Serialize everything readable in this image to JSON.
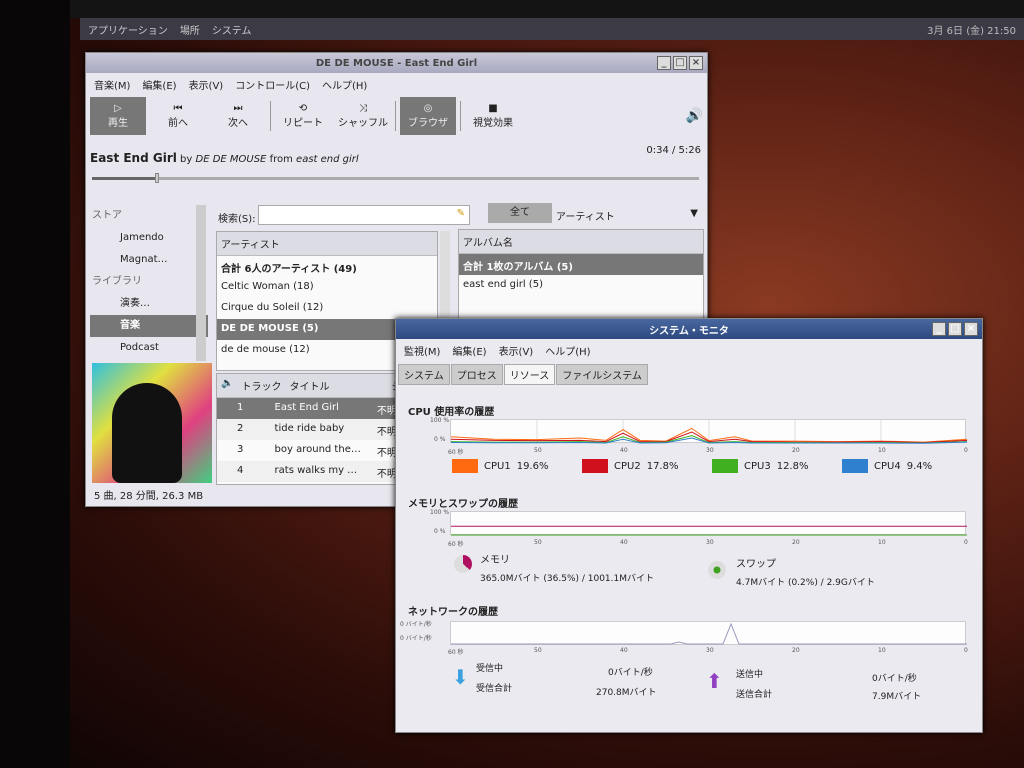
{
  "panel": {
    "menus": [
      "アプリケーション",
      "場所",
      "システム"
    ],
    "clock": "3月 6日 (金) 21:50"
  },
  "player": {
    "title": "DE DE MOUSE - East End Girl",
    "menus": [
      "音楽(M)",
      "編集(E)",
      "表示(V)",
      "コントロール(C)",
      "ヘルプ(H)"
    ],
    "toolbar": [
      "再生",
      "前へ",
      "次へ",
      "リピート",
      "シャッフル",
      "ブラウザ",
      "視覚効果"
    ],
    "now_playing": {
      "title": "East End Girl",
      "by": "by",
      "artist": "DE DE MOUSE",
      "from": "from",
      "album": "east end girl"
    },
    "time": "0:34 / 5:26",
    "progress": 0.104,
    "sidebar": [
      {
        "label": "ストア",
        "type": "header"
      },
      {
        "label": "Jamendo"
      },
      {
        "label": "Magnat…"
      },
      {
        "label": "ライブラリ",
        "type": "header"
      },
      {
        "label": "演奏…"
      },
      {
        "label": "音楽",
        "selected": true
      },
      {
        "label": "Podcast"
      }
    ],
    "search_label": "検索(S):",
    "search_value": "",
    "all_button": "全て",
    "filter_select": "アーティスト",
    "artists_header": "アーティスト",
    "artists": [
      "合計 6人のアーティスト (49)",
      "Celtic Woman (18)",
      "Cirque du Soleil (12)",
      "DE DE MOUSE (5)",
      "de de mouse (12)"
    ],
    "albums_header": "アルバム名",
    "albums": [
      "合計 1枚のアルバム (5)",
      "east end girl (5)"
    ],
    "track_headers": [
      "トラック",
      "タイトル",
      "ジャ"
    ],
    "tracks": [
      {
        "n": "1",
        "title": "East End Girl",
        "genre": "不明"
      },
      {
        "n": "2",
        "title": "tide ride baby",
        "genre": "不明"
      },
      {
        "n": "3",
        "title": "boy around the…",
        "genre": "不明"
      },
      {
        "n": "4",
        "title": "rats walks my …",
        "genre": "不明"
      }
    ],
    "status": "5 曲, 28 分間, 26.3 MB"
  },
  "monitor": {
    "title": "システム・モニタ",
    "menus": [
      "監視(M)",
      "編集(E)",
      "表示(V)",
      "ヘルプ(H)"
    ],
    "tabs": [
      "システム",
      "プロセス",
      "リソース",
      "ファイルシステム"
    ],
    "active_tab": "リソース",
    "cpu_title": "CPU 使用率の履歴",
    "mem_title": "メモリとスワップの履歴",
    "net_title": "ネットワークの履歴",
    "y_labels": [
      "100 %",
      "0 %"
    ],
    "net_y_labels": [
      "0 バイト/秒",
      "0 バイト/秒"
    ],
    "x_ticks": [
      "60 秒",
      "50",
      "40",
      "30",
      "20",
      "10",
      "0"
    ],
    "cpus": [
      {
        "name": "CPU1",
        "value": "19.6%",
        "color": "#ff6a10"
      },
      {
        "name": "CPU2",
        "value": "17.8%",
        "color": "#d0101c"
      },
      {
        "name": "CPU3",
        "value": "12.8%",
        "color": "#40b020"
      },
      {
        "name": "CPU4",
        "value": "9.4%",
        "color": "#3080d0"
      }
    ],
    "memory": {
      "label": "メモリ",
      "value": "365.0Mバイト (36.5%) / 1001.1Mバイト",
      "percent": 36.5,
      "color": "#b01060"
    },
    "swap": {
      "label": "スワップ",
      "value": "4.7Mバイト (0.2%) / 2.9Gバイト",
      "percent": 0.2,
      "color": "#40a020"
    },
    "net": {
      "recv_label": "受信中",
      "recv_total_label": "受信合計",
      "recv_rate": "0バイト/秒",
      "recv_total": "270.8Mバイト",
      "send_label": "送信中",
      "send_total_label": "送信合計",
      "send_rate": "0バイト/秒",
      "send_total": "7.9Mバイト"
    },
    "chart_data": {
      "type": "line",
      "x": [
        60,
        55,
        50,
        45,
        42,
        40,
        38,
        35,
        32,
        30,
        27,
        25,
        20,
        15,
        10,
        5,
        0
      ],
      "series": [
        {
          "name": "CPU1",
          "values": [
            30,
            20,
            18,
            25,
            15,
            60,
            15,
            12,
            65,
            14,
            30,
            12,
            12,
            10,
            12,
            8,
            20
          ]
        },
        {
          "name": "CPU2",
          "values": [
            20,
            15,
            14,
            15,
            10,
            45,
            10,
            10,
            50,
            10,
            20,
            10,
            8,
            8,
            10,
            6,
            15
          ]
        },
        {
          "name": "CPU3",
          "values": [
            10,
            8,
            8,
            10,
            6,
            30,
            6,
            8,
            35,
            6,
            10,
            6,
            6,
            5,
            6,
            4,
            10
          ]
        },
        {
          "name": "CPU4",
          "values": [
            6,
            5,
            5,
            6,
            4,
            20,
            4,
            5,
            25,
            4,
            6,
            4,
            4,
            4,
            4,
            3,
            8
          ]
        }
      ]
    }
  }
}
